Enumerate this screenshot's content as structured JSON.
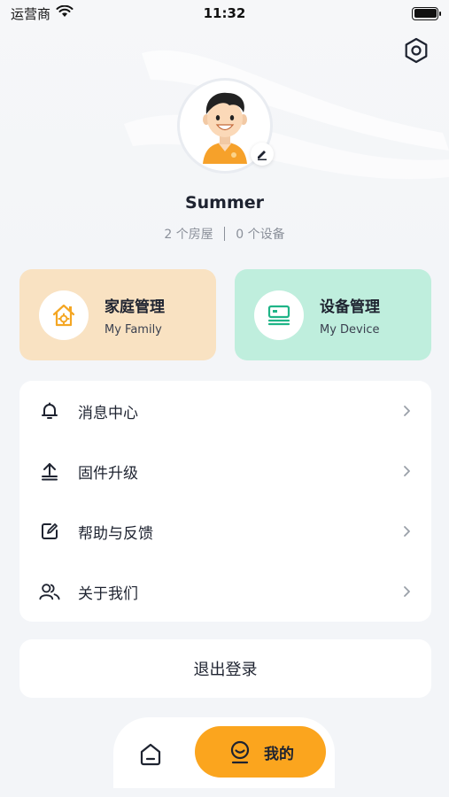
{
  "status_bar": {
    "carrier": "运营商",
    "time": "11:32",
    "icons": [
      "wifi-icon",
      "battery-icon"
    ]
  },
  "header": {
    "settings_icon": "gear-hexagon-icon"
  },
  "profile": {
    "name": "Summer",
    "houses": "2 个房屋",
    "devices": "0 个设备",
    "avatar_icon": "avatar-illustration",
    "edit_icon": "pencil-icon"
  },
  "cards": [
    {
      "title": "家庭管理",
      "subtitle": "My Family",
      "icon": "house-gear-icon",
      "color": "#f9e2c2",
      "accent": "#f4a623"
    },
    {
      "title": "设备管理",
      "subtitle": "My Device",
      "icon": "device-icon",
      "color": "#bfeedd",
      "accent": "#1fb487"
    }
  ],
  "menu": {
    "items": [
      {
        "label": "消息中心",
        "icon": "bell-icon"
      },
      {
        "label": "固件升级",
        "icon": "upgrade-icon"
      },
      {
        "label": "帮助与反馈",
        "icon": "edit-note-icon"
      },
      {
        "label": "关于我们",
        "icon": "users-icon"
      }
    ]
  },
  "logout": {
    "label": "退出登录"
  },
  "bottom_nav": {
    "home_icon": "home-icon",
    "mine_label": "我的",
    "mine_icon": "smile-face-icon",
    "active_color": "#fba51e"
  }
}
